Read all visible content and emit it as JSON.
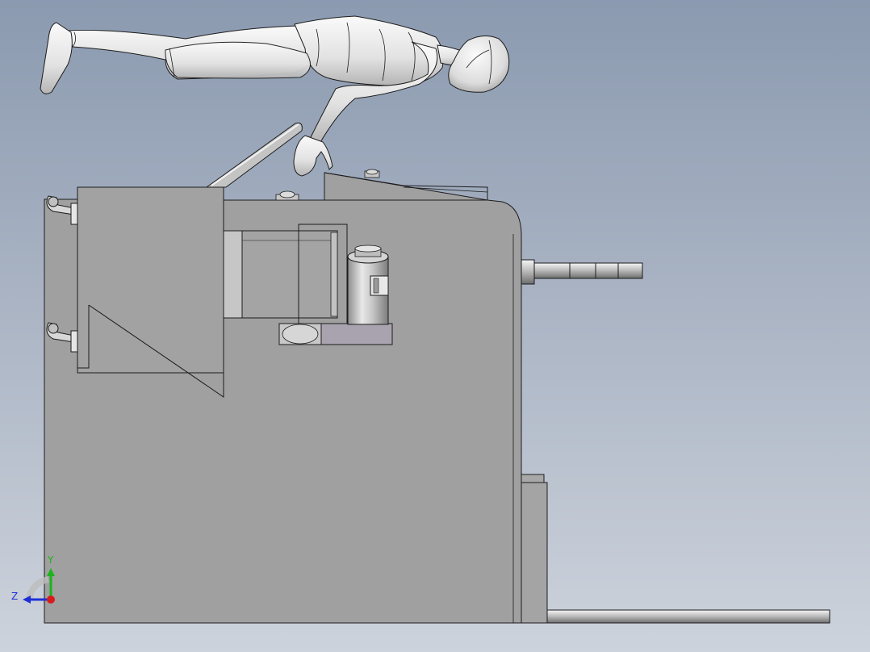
{
  "viewport": {
    "background_top": "#8b9ab0",
    "background_bottom": "#cdd3dc"
  },
  "model": {
    "body_color": "#a0a0a0",
    "edge_color": "#1c1c1c",
    "figure_color": "#e6e6e6"
  },
  "triad": {
    "y_label": "Y",
    "z_label": "Z",
    "y_color": "#1db31d",
    "z_color": "#1f2fd6",
    "x_color": "#d81c1c"
  }
}
